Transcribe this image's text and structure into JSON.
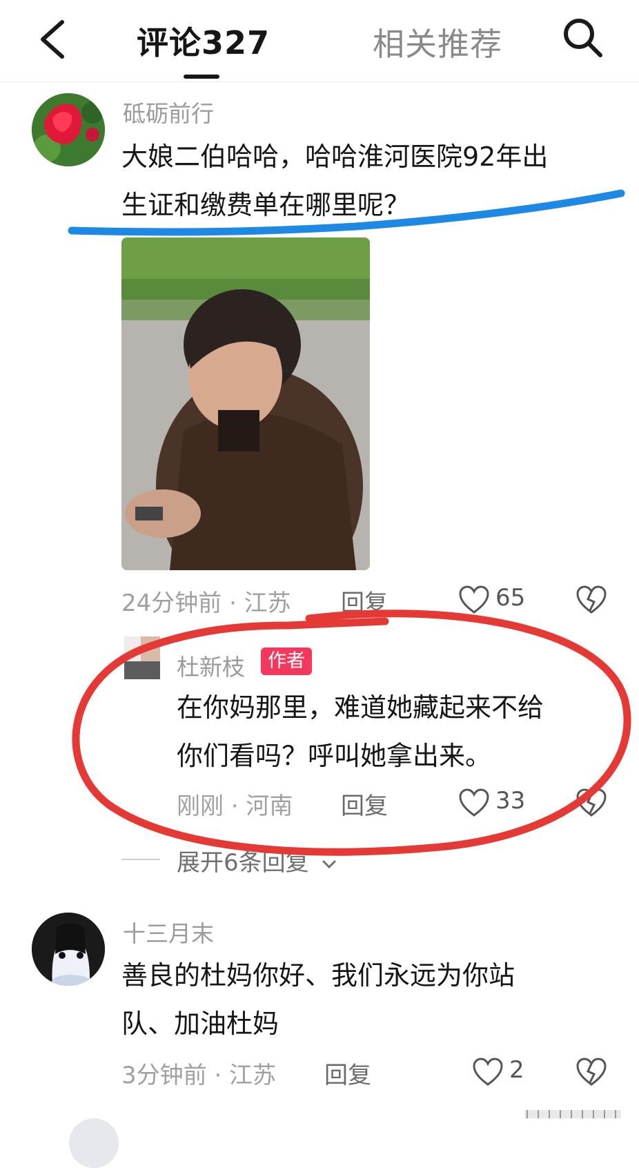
{
  "header": {
    "tab_comments": "评论327",
    "tab_related": "相关推荐"
  },
  "comments": [
    {
      "username": "砥砺前行",
      "text_line1": "大娘二伯哈哈，哈哈淮河医院92年出",
      "text_line2": "生证和缴费单在哪里呢？",
      "time": "24分钟前 · 江苏",
      "reply_label": "回复",
      "likes": "65"
    },
    {
      "username": "杜新枝",
      "badge": "作者",
      "text_line1": "在你妈那里，难道她藏起来不给",
      "text_line2": "你们看吗？呼叫她拿出来。",
      "time": "刚刚 · 河南",
      "reply_label": "回复",
      "likes": "33"
    },
    {
      "username": "十三月末",
      "text_line1": "善良的杜妈你好、我们永远为你站",
      "text_line2": "队、加油杜妈",
      "time": "3分钟前 · 江苏",
      "reply_label": "回复",
      "likes": "2"
    }
  ],
  "expand_replies": "展开6条回复",
  "annotations": {
    "underline_color": "#1e88e5",
    "circle_color": "#e53935"
  },
  "icons": [
    "back-icon",
    "search-icon",
    "heart-icon",
    "dislike-icon",
    "chevron-down-icon"
  ]
}
